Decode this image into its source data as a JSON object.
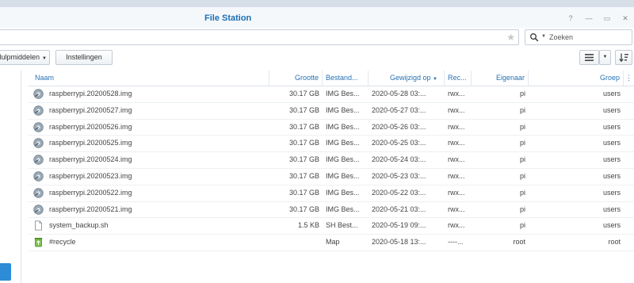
{
  "window": {
    "title": "File Station",
    "help_label": "?",
    "minimize_label": "—",
    "maximize_label": "▭",
    "close_label": "✕"
  },
  "search": {
    "placeholder": "Zoeken"
  },
  "toolbar": {
    "tools_label": "Hulpmiddelen",
    "settings_label": "Instellingen"
  },
  "columns": {
    "name": "Naam",
    "size": "Grootte",
    "type": "Bestand...",
    "modified": "Gewijzigd op",
    "permissions": "Rec...",
    "owner": "Eigenaar",
    "group": "Groep"
  },
  "files": [
    {
      "name": "raspberrypi.20200528.img",
      "size": "30.17 GB",
      "type": "IMG Bes...",
      "modified": "2020-05-28 03:...",
      "perm": "rwx...",
      "owner": "pi",
      "group": "users",
      "icon": "disk-image-icon"
    },
    {
      "name": "raspberrypi.20200527.img",
      "size": "30.17 GB",
      "type": "IMG Bes...",
      "modified": "2020-05-27 03:...",
      "perm": "rwx...",
      "owner": "pi",
      "group": "users",
      "icon": "disk-image-icon"
    },
    {
      "name": "raspberrypi.20200526.img",
      "size": "30.17 GB",
      "type": "IMG Bes...",
      "modified": "2020-05-26 03:...",
      "perm": "rwx...",
      "owner": "pi",
      "group": "users",
      "icon": "disk-image-icon"
    },
    {
      "name": "raspberrypi.20200525.img",
      "size": "30.17 GB",
      "type": "IMG Bes...",
      "modified": "2020-05-25 03:...",
      "perm": "rwx...",
      "owner": "pi",
      "group": "users",
      "icon": "disk-image-icon"
    },
    {
      "name": "raspberrypi.20200524.img",
      "size": "30.17 GB",
      "type": "IMG Bes...",
      "modified": "2020-05-24 03:...",
      "perm": "rwx...",
      "owner": "pi",
      "group": "users",
      "icon": "disk-image-icon"
    },
    {
      "name": "raspberrypi.20200523.img",
      "size": "30.17 GB",
      "type": "IMG Bes...",
      "modified": "2020-05-23 03:...",
      "perm": "rwx...",
      "owner": "pi",
      "group": "users",
      "icon": "disk-image-icon"
    },
    {
      "name": "raspberrypi.20200522.img",
      "size": "30.17 GB",
      "type": "IMG Bes...",
      "modified": "2020-05-22 03:...",
      "perm": "rwx...",
      "owner": "pi",
      "group": "users",
      "icon": "disk-image-icon"
    },
    {
      "name": "raspberrypi.20200521.img",
      "size": "30.17 GB",
      "type": "IMG Bes...",
      "modified": "2020-05-21 03:...",
      "perm": "rwx...",
      "owner": "pi",
      "group": "users",
      "icon": "disk-image-icon"
    },
    {
      "name": "system_backup.sh",
      "size": "1.5 KB",
      "type": "SH Best...",
      "modified": "2020-05-19 09:...",
      "perm": "rwx...",
      "owner": "pi",
      "group": "users",
      "icon": "document-icon"
    },
    {
      "name": "#recycle",
      "size": "",
      "type": "Map",
      "modified": "2020-05-18 13:...",
      "perm": "----...",
      "owner": "root",
      "group": "root",
      "icon": "recycle-bin-icon"
    }
  ],
  "colors": {
    "accent": "#1a6fb8",
    "header_text": "#2672b5",
    "sidebar_handle": "#2e8bd6"
  }
}
